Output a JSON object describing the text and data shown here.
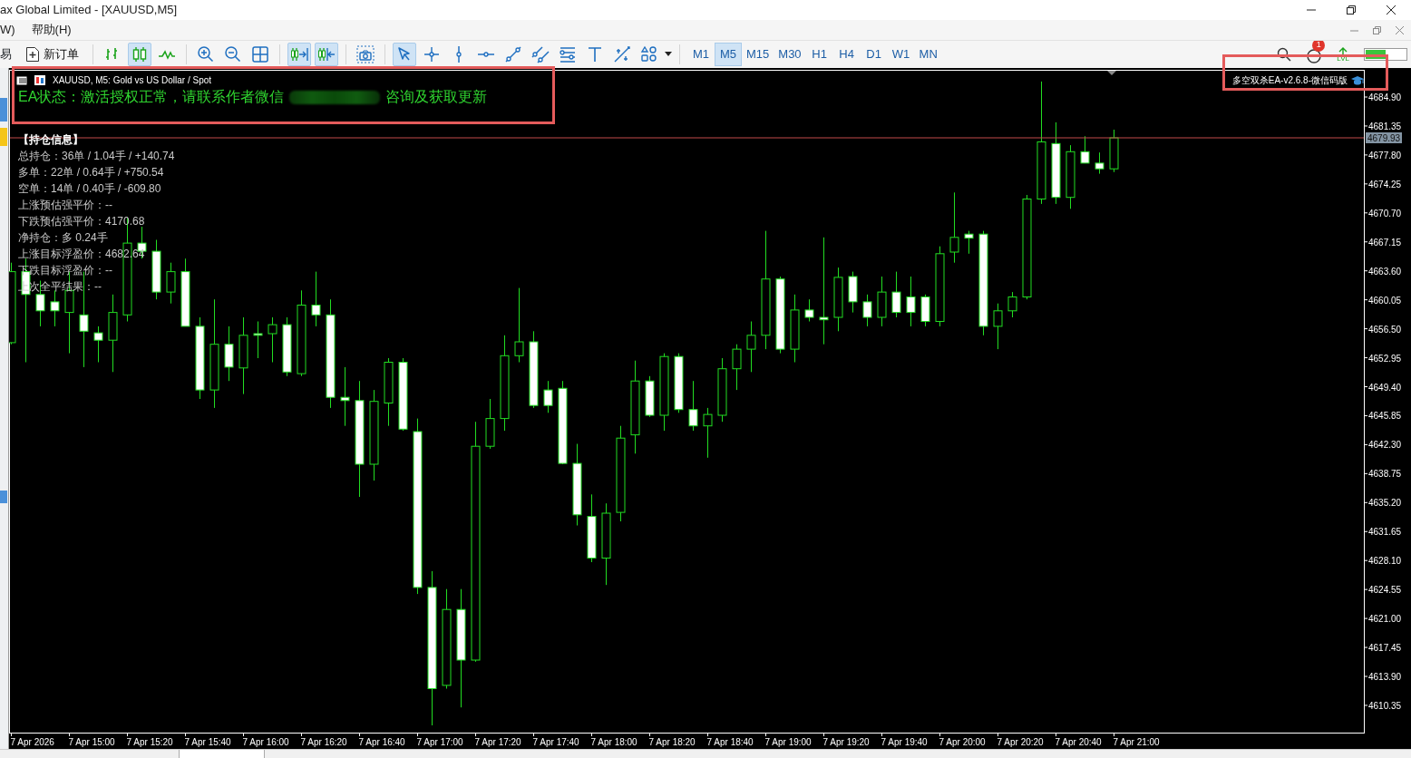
{
  "window": {
    "title": "ax Global Limited - [XAUUSD,M5]"
  },
  "menu": [
    {
      "label": "W)"
    },
    {
      "label": "帮助(H)"
    }
  ],
  "toolbar": {
    "trade_label": "易",
    "new_order": "新订单",
    "groups": [
      [
        {
          "kind": "bars",
          "selected": false
        },
        {
          "kind": "candles",
          "selected": true
        },
        {
          "kind": "line",
          "selected": false
        }
      ],
      [
        {
          "kind": "zoomin",
          "selected": false
        },
        {
          "kind": "zoomout",
          "selected": false
        },
        {
          "kind": "tile",
          "selected": false
        }
      ],
      [
        {
          "kind": "autoscroll",
          "selected": true
        },
        {
          "kind": "shift",
          "selected": true
        }
      ],
      [
        {
          "kind": "screenshot",
          "selected": false
        }
      ],
      [
        {
          "kind": "cursor",
          "selected": true
        },
        {
          "kind": "crosshair",
          "selected": false
        },
        {
          "kind": "vline",
          "selected": false
        },
        {
          "kind": "hline",
          "selected": false
        },
        {
          "kind": "trend",
          "selected": false
        },
        {
          "kind": "channel",
          "selected": false
        },
        {
          "kind": "fibo",
          "selected": false
        },
        {
          "kind": "text",
          "selected": false
        },
        {
          "kind": "arrows",
          "selected": false
        },
        {
          "kind": "shapes",
          "selected": false
        }
      ]
    ],
    "timeframes": [
      {
        "label": "M1",
        "selected": false
      },
      {
        "label": "M5",
        "selected": true
      },
      {
        "label": "M15",
        "selected": false
      },
      {
        "label": "M30",
        "selected": false
      },
      {
        "label": "H1",
        "selected": false
      },
      {
        "label": "H4",
        "selected": false
      },
      {
        "label": "D1",
        "selected": false
      },
      {
        "label": "W1",
        "selected": false
      },
      {
        "label": "MN",
        "selected": false
      }
    ],
    "notification_count": "1",
    "lvl_label": "LVL"
  },
  "chart": {
    "header": "XAUUSD, M5: Gold vs US Dollar / Spot",
    "ea_status_prefix": "EA状态：激活授权正常，请联系作者微信",
    "ea_status_suffix": "咨询及获取更新",
    "ea_name": "多空双杀EA-v2.6.8-微信码版",
    "info_title": "【持仓信息】",
    "info_lines": [
      "总持仓：36单 / 1.04手 / +140.74",
      "多单：22单 / 0.64手 / +750.54",
      "空单：14单 / 0.40手 / -609.80",
      "上涨预估强平价：--",
      "下跌预估强平价：4170.68",
      "净持仓：多 0.24手",
      "上涨目标浮盈价：4682.64",
      "下跌目标浮盈价：--",
      "上次全平结果：--"
    ],
    "current_price": "4679.93",
    "price_labels": [
      "4684.90",
      "4681.35",
      "4677.80",
      "4674.25",
      "4670.70",
      "4667.15",
      "4663.60",
      "4660.05",
      "4656.50",
      "4652.95",
      "4649.40",
      "4645.85",
      "4642.30",
      "4638.75",
      "4635.20",
      "4631.65",
      "4628.10",
      "4624.55",
      "4621.00",
      "4617.45",
      "4613.90",
      "4610.35"
    ],
    "time_labels": [
      "7 Apr 2026",
      "7 Apr 15:00",
      "7 Apr 15:20",
      "7 Apr 15:40",
      "7 Apr 16:00",
      "7 Apr 16:20",
      "7 Apr 16:40",
      "7 Apr 17:00",
      "7 Apr 17:20",
      "7 Apr 17:40",
      "7 Apr 18:00",
      "7 Apr 18:20",
      "7 Apr 18:40",
      "7 Apr 19:00",
      "7 Apr 19:20",
      "7 Apr 19:40",
      "7 Apr 20:00",
      "7 Apr 20:20",
      "7 Apr 20:40",
      "7 Apr 21:00"
    ]
  }
}
